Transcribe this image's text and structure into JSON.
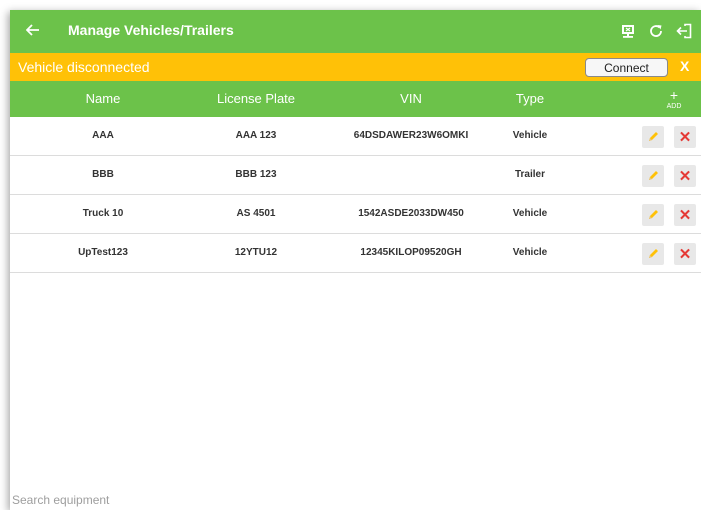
{
  "toolbar": {
    "title": "Manage Vehicles/Trailers",
    "back_icon": "arrow-back-icon",
    "icons": [
      "monitor-icon",
      "refresh-icon",
      "logout-icon"
    ]
  },
  "banner": {
    "message": "Vehicle disconnected",
    "connect_label": "Connect",
    "dismiss_label": "X"
  },
  "table": {
    "headers": {
      "name": "Name",
      "license_plate": "License Plate",
      "vin": "VIN",
      "type": "Type",
      "add": "ADD"
    },
    "rows": [
      {
        "name": "AAA",
        "license_plate": "AAA 123",
        "vin": "64DSDAWER23W6OMKI",
        "type": "Vehicle"
      },
      {
        "name": "BBB",
        "license_plate": "BBB 123",
        "vin": "",
        "type": "Trailer"
      },
      {
        "name": "Truck 10",
        "license_plate": "AS 4501",
        "vin": "1542ASDE2033DW450",
        "type": "Vehicle"
      },
      {
        "name": "UpTest123",
        "license_plate": "12YTU12",
        "vin": "12345KILOP09520GH",
        "type": "Vehicle"
      }
    ]
  },
  "search": {
    "placeholder": "Search equipment"
  },
  "colors": {
    "primary_green": "#6cc24a",
    "banner_yellow": "#ffc107",
    "delete_red": "#e53935"
  }
}
